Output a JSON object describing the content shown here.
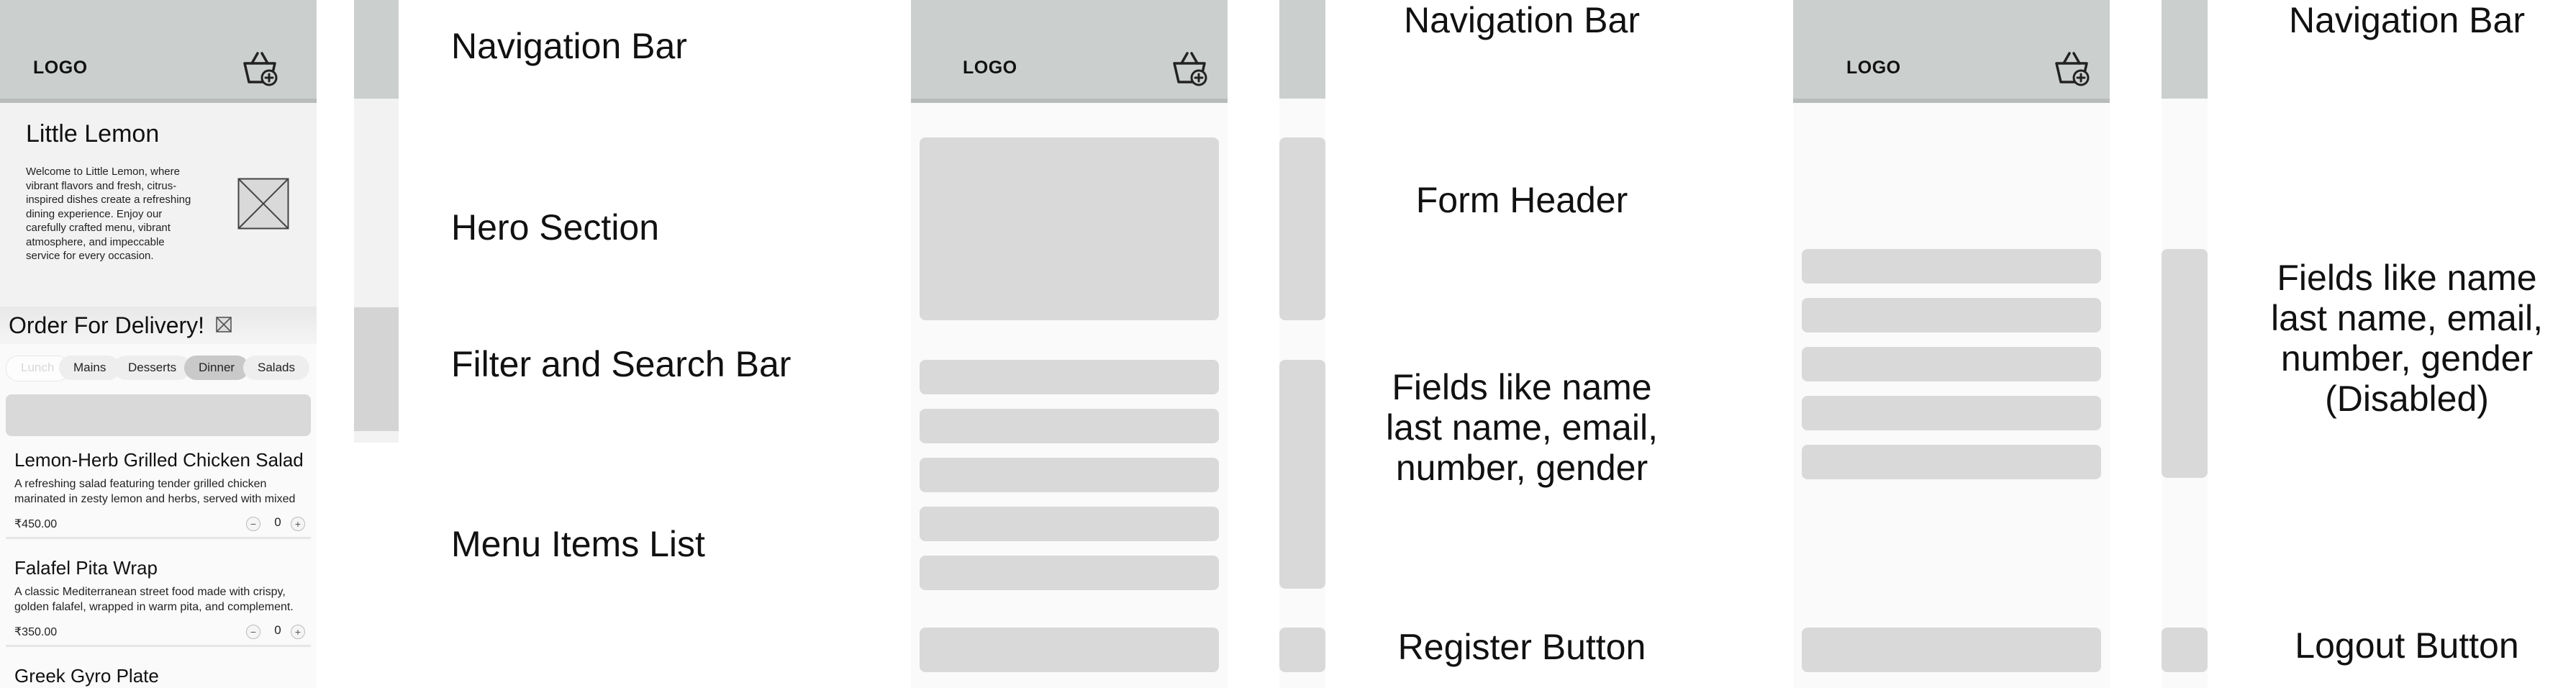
{
  "screen1": {
    "logo": "LOGO",
    "cart_icon": "shopping-basket-plus-icon",
    "hero": {
      "title": "Little Lemon",
      "text": "Welcome to Little Lemon, where vibrant flavors and fresh, citrus-inspired dishes create a refreshing dining experience. Enjoy our carefully crafted menu, vibrant atmosphere, and impeccable service for every occasion.",
      "image_icon": "image-placeholder-icon"
    },
    "order_title": "Order For Delivery!",
    "order_icon": "image-placeholder-icon",
    "filters": [
      {
        "label": "Lunch",
        "state": "muted"
      },
      {
        "label": "Mains",
        "state": "default"
      },
      {
        "label": "Desserts",
        "state": "default"
      },
      {
        "label": "Dinner",
        "state": "active"
      },
      {
        "label": "Salads",
        "state": "default"
      }
    ],
    "menu_items": [
      {
        "title": "Lemon-Herb Grilled Chicken Salad",
        "desc1": "A refreshing salad featuring tender grilled chicken",
        "desc2": "marinated in zesty lemon and herbs, served with mixed",
        "price": "₹450.00",
        "qty": "0"
      },
      {
        "title": "Falafel Pita Wrap",
        "desc1": " A classic Mediterranean street food made with crispy,",
        "desc2": "golden falafel, wrapped in warm pita, and complement.",
        "price": "₹350.00",
        "qty": "0"
      },
      {
        "title": "Greek Gyro Plate"
      }
    ],
    "minus_symbol": "−",
    "plus_symbol": "+"
  },
  "screen2": {
    "logo": "LOGO"
  },
  "screen3": {
    "logo": "LOGO"
  },
  "annotations": {
    "navigation_bar_1": "Navigation Bar",
    "hero_section": "Hero Section",
    "filter_search_bar": "Filter and Search Bar",
    "menu_items_list": "Menu Items List",
    "navigation_bar_2": "Navigation Bar",
    "form_header": "Form Header",
    "fields_2_l1": "Fields like name",
    "fields_2_l2": "last name, email,",
    "fields_2_l3": "number, gender",
    "register_button": "Register Button",
    "navigation_bar_3": "Navigation Bar",
    "fields_3_l1": "Fields like name",
    "fields_3_l2": "last name, email,",
    "fields_3_l3": "number, gender",
    "fields_3_l4": "(Disabled)",
    "logout_button": "Logout Button"
  },
  "colors": {
    "nav_gray": "#cbcfcd",
    "placeholder_gray": "#d9d9d9",
    "screen_bg": "#fafafa"
  }
}
